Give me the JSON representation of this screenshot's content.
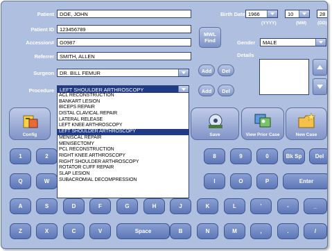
{
  "form": {
    "patient_label": "Patient",
    "patient_value": "DOE, JOHN",
    "patient_id_label": "Patient ID",
    "patient_id_value": "123456789",
    "accession_label": "Accession#",
    "accession_value": "G0987",
    "referrer_label": "Referrer",
    "referrer_value": "SMITH, ALLEN",
    "surgeon_label": "Surgeon",
    "surgeon_value": "DR. BILL FEMUR",
    "procedure_label": "Procedure",
    "procedure_value": "LEFT SHOULDER ARTHROSCOPY",
    "birth_date_label": "Birth Date",
    "birth_year": "1966",
    "birth_month": "10",
    "birth_day": "28",
    "yyyy_label": "(YYYY)",
    "mm_label": "(MM)",
    "dd_label": "(DD)",
    "gender_label": "Gender",
    "gender_value": "MALE",
    "details_label": "Details",
    "mwl_find_line1": "MWL",
    "mwl_find_line2": "Find",
    "add_label": "Add",
    "del_label": "Del"
  },
  "procedure_options": [
    "ACL RECONSTRUCTION",
    "BANKART LESION",
    "BICEPS REPAIR",
    "DISTAL CLAVICAL REPAIR",
    "LATERAL RELEASE",
    "LEFT KNEE ARTHROSCOPY",
    "LEFT SHOULDER ARTHROSCOPY",
    "MENISCAL REPAIR",
    "MENISECTOMY",
    "PCL RECONSTRUCTION",
    "RIGHT KNEE ARTHROSCOPY",
    "RIGHT SHOULDER ARTHROSCOPY",
    "ROTATOR CUFF REPAIR",
    "SLAP LESION",
    "SUBACROMIAL DECOMPRESSION"
  ],
  "selected_option": "LEFT SHOULDER ARTHROSCOPY",
  "toolbar": {
    "config": "Config",
    "save": "Save",
    "view_prior": "View Prior Case",
    "new_case": "New Case"
  },
  "keyboard": {
    "row1": [
      "1",
      "2",
      "8",
      "9",
      "0",
      "Bk Sp",
      "Del"
    ],
    "row2": [
      "Q",
      "W",
      "I",
      "O",
      "P",
      "Enter"
    ],
    "row3": [
      "A",
      "S",
      "D",
      "F",
      "G",
      "H",
      "J",
      "K",
      "L",
      "'",
      "-",
      "_"
    ],
    "row4": [
      "Z",
      "X",
      "C",
      "V",
      "Space",
      "B",
      "N",
      "M",
      ",",
      ".",
      "/"
    ]
  },
  "colors": {
    "panel": "#aebfe0",
    "key": "#6f86c2",
    "selection": "#1f3a86"
  }
}
